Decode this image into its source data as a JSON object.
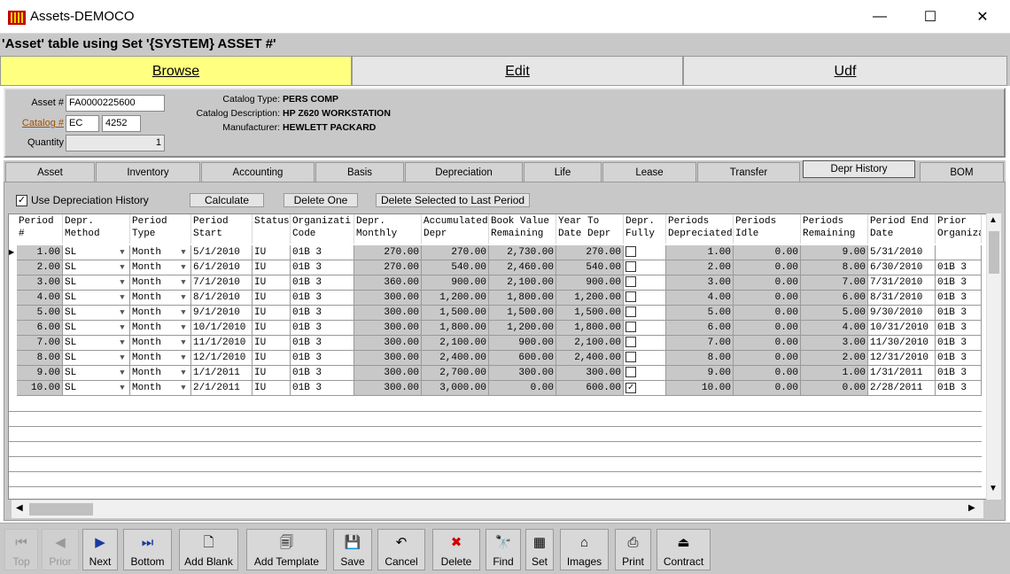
{
  "window": {
    "title": "Assets-DEMOCO",
    "minimize": "—",
    "maximize": "☐",
    "close": "✕"
  },
  "subtitle": "'Asset' table using Set '{SYSTEM} ASSET #'",
  "main_tabs": [
    "Browse",
    "Edit",
    "Udf"
  ],
  "header": {
    "asset_label": "Asset #",
    "asset_value": "FA0000225600",
    "catalog_label": "Catalog #",
    "catalog_prefix": "EC",
    "catalog_number": "4252",
    "quantity_label": "Quantity",
    "quantity_value": "1",
    "catalog_type_label": "Catalog Type:",
    "catalog_type_value": "PERS COMP",
    "catalog_desc_label": "Catalog Description:",
    "catalog_desc_value": "HP Z620 WORKSTATION",
    "manufacturer_label": "Manufacturer:",
    "manufacturer_value": "HEWLETT PACKARD"
  },
  "sub_tabs": [
    "Asset",
    "Inventory",
    "Accounting",
    "Basis",
    "Depreciation",
    "Life",
    "Lease",
    "Transfer",
    "Depr History",
    "BOM"
  ],
  "controls": {
    "use_history_label": "Use Depreciation History",
    "use_history_checked": true,
    "calculate": "Calculate",
    "delete_one": "Delete One",
    "delete_selected": "Delete Selected to Last Period"
  },
  "grid": {
    "columns": [
      [
        "Period",
        "#"
      ],
      [
        "Depr.",
        "Method"
      ],
      [
        "Period",
        "Type"
      ],
      [
        "Period",
        "Start"
      ],
      [
        "Status",
        ""
      ],
      [
        "Organizati",
        "Code"
      ],
      [
        "Depr.",
        "Monthly"
      ],
      [
        "Accumulated",
        "Depr"
      ],
      [
        "Book Value",
        "Remaining"
      ],
      [
        "Year To",
        "Date Depr"
      ],
      [
        "Depr.",
        "Fully"
      ],
      [
        "Periods",
        "Depreciated"
      ],
      [
        "Periods",
        "Idle"
      ],
      [
        "Periods",
        "Remaining"
      ],
      [
        "Period End",
        "Date"
      ],
      [
        "Prior",
        "Organiza"
      ]
    ],
    "rows": [
      [
        "1.00",
        "SL",
        "Month",
        "5/1/2010",
        "IU",
        "01B 3",
        "270.00",
        "270.00",
        "2,730.00",
        "270.00",
        false,
        "1.00",
        "0.00",
        "9.00",
        "5/31/2010",
        ""
      ],
      [
        "2.00",
        "SL",
        "Month",
        "6/1/2010",
        "IU",
        "01B 3",
        "270.00",
        "540.00",
        "2,460.00",
        "540.00",
        false,
        "2.00",
        "0.00",
        "8.00",
        "6/30/2010",
        "01B 3"
      ],
      [
        "3.00",
        "SL",
        "Month",
        "7/1/2010",
        "IU",
        "01B 3",
        "360.00",
        "900.00",
        "2,100.00",
        "900.00",
        false,
        "3.00",
        "0.00",
        "7.00",
        "7/31/2010",
        "01B 3"
      ],
      [
        "4.00",
        "SL",
        "Month",
        "8/1/2010",
        "IU",
        "01B 3",
        "300.00",
        "1,200.00",
        "1,800.00",
        "1,200.00",
        false,
        "4.00",
        "0.00",
        "6.00",
        "8/31/2010",
        "01B 3"
      ],
      [
        "5.00",
        "SL",
        "Month",
        "9/1/2010",
        "IU",
        "01B 3",
        "300.00",
        "1,500.00",
        "1,500.00",
        "1,500.00",
        false,
        "5.00",
        "0.00",
        "5.00",
        "9/30/2010",
        "01B 3"
      ],
      [
        "6.00",
        "SL",
        "Month",
        "10/1/2010",
        "IU",
        "01B 3",
        "300.00",
        "1,800.00",
        "1,200.00",
        "1,800.00",
        false,
        "6.00",
        "0.00",
        "4.00",
        "10/31/2010",
        "01B 3"
      ],
      [
        "7.00",
        "SL",
        "Month",
        "11/1/2010",
        "IU",
        "01B 3",
        "300.00",
        "2,100.00",
        "900.00",
        "2,100.00",
        false,
        "7.00",
        "0.00",
        "3.00",
        "11/30/2010",
        "01B 3"
      ],
      [
        "8.00",
        "SL",
        "Month",
        "12/1/2010",
        "IU",
        "01B 3",
        "300.00",
        "2,400.00",
        "600.00",
        "2,400.00",
        false,
        "8.00",
        "0.00",
        "2.00",
        "12/31/2010",
        "01B 3"
      ],
      [
        "9.00",
        "SL",
        "Month",
        "1/1/2011",
        "IU",
        "01B 3",
        "300.00",
        "2,700.00",
        "300.00",
        "300.00",
        false,
        "9.00",
        "0.00",
        "1.00",
        "1/31/2011",
        "01B 3"
      ],
      [
        "10.00",
        "SL",
        "Month",
        "2/1/2011",
        "IU",
        "01B 3",
        "300.00",
        "3,000.00",
        "0.00",
        "600.00",
        true,
        "10.00",
        "0.00",
        "0.00",
        "2/28/2011",
        "01B 3"
      ]
    ]
  },
  "toolbar": [
    {
      "label": "Top",
      "icon": "⏮",
      "enabled": false
    },
    {
      "label": "Prior",
      "icon": "◀",
      "enabled": false
    },
    {
      "label": "Next",
      "icon": "▶",
      "enabled": true
    },
    {
      "label": "Bottom",
      "icon": "⏭",
      "enabled": true
    },
    {
      "label": "Add Blank",
      "icon": "🗋",
      "enabled": true
    },
    {
      "label": "Add Template",
      "icon": "🗐",
      "enabled": true
    },
    {
      "label": "Save",
      "icon": "💾",
      "enabled": true
    },
    {
      "label": "Cancel",
      "icon": "↶",
      "enabled": true
    },
    {
      "label": "Delete",
      "icon": "✖",
      "enabled": true
    },
    {
      "label": "Find",
      "icon": "🔭",
      "enabled": true
    },
    {
      "label": "Set",
      "icon": "▦",
      "enabled": true
    },
    {
      "label": "Images",
      "icon": "⌂",
      "enabled": true
    },
    {
      "label": "Print",
      "icon": "⎙",
      "enabled": true
    },
    {
      "label": "Contract",
      "icon": "⏏",
      "enabled": true
    }
  ],
  "colors": {
    "browse_tab": "#ffff80",
    "panel": "#c8c8c8",
    "delete_icon": "#d00000",
    "nav_icon": "#1a3aa0"
  }
}
